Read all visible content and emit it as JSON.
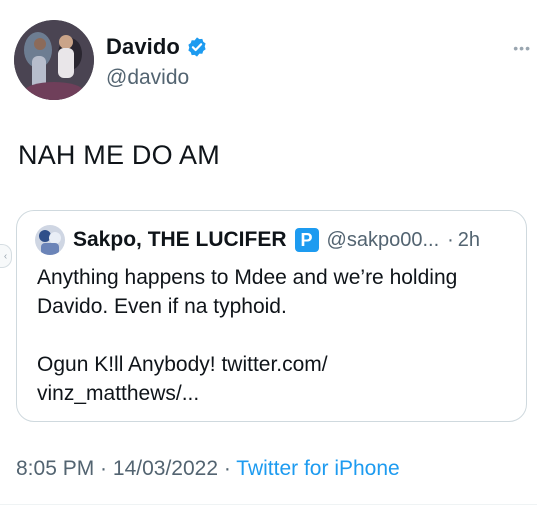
{
  "tweet": {
    "author": {
      "name": "Davido",
      "handle": "@davido",
      "verified": true
    },
    "more_label": "•••",
    "text": "NAH ME DO AM",
    "quote": {
      "author_name": "Sakpo, THE LUCIFER",
      "badge_letter": "P",
      "handle": "@sakpo00...",
      "separator": "·",
      "time": "2h",
      "lines": [
        "Anything happens to Mdee and we’re holding",
        "Davido. Even if na typhoid.",
        "Ogun K!ll Anybody! twitter.com/",
        "vinz_matthews/..."
      ]
    },
    "meta": {
      "time": "8:05 PM",
      "sep1": " · ",
      "date": "14/03/2022",
      "sep2": " · ",
      "source": "Twitter for iPhone"
    }
  },
  "icons": {
    "verified": "verified-badge-icon",
    "more": "more-dots-icon",
    "prev": "chevron-left-icon"
  },
  "colors": {
    "accent": "#1d9bf0",
    "secondary_text": "#536471",
    "border": "#cfd9de"
  }
}
